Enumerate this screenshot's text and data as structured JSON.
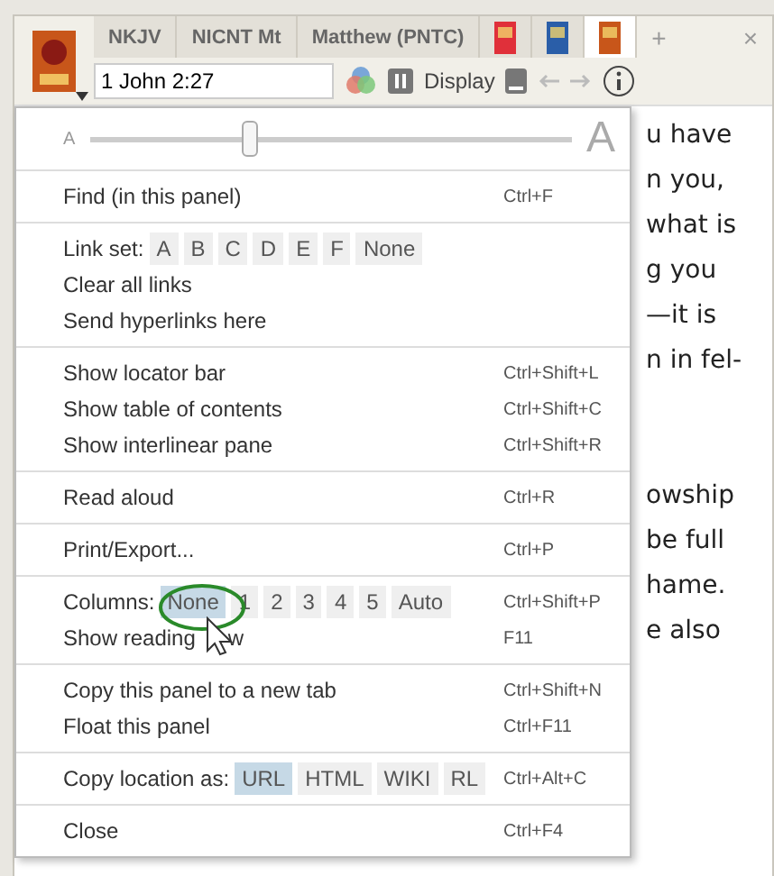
{
  "tabs": [
    {
      "kind": "text",
      "label": "NKJV",
      "selected": false
    },
    {
      "kind": "text",
      "label": "NICNT Mt",
      "selected": false
    },
    {
      "kind": "text",
      "label": "Matthew (PNTC)",
      "selected": false
    },
    {
      "kind": "cover",
      "color": "#e0303a",
      "selected": false
    },
    {
      "kind": "cover",
      "color": "#2a5ea8",
      "selected": false
    },
    {
      "kind": "cover",
      "color": "#c8561a",
      "selected": true
    }
  ],
  "new_tab": "+",
  "close_tab": "×",
  "toolbar": {
    "reference": "1 John 2:27",
    "display": "Display"
  },
  "font_size": {
    "small": "A",
    "large": "A",
    "level": 0.33
  },
  "menu": [
    [
      {
        "kind": "item",
        "label": "Find (in this panel)",
        "shortcut": "Ctrl+F"
      }
    ],
    [
      {
        "kind": "choices",
        "label": "Link set:",
        "options": [
          {
            "label": "A",
            "selected": false
          },
          {
            "label": "B",
            "selected": false
          },
          {
            "label": "C",
            "selected": false
          },
          {
            "label": "D",
            "selected": false
          },
          {
            "label": "E",
            "selected": false
          },
          {
            "label": "F",
            "selected": false
          },
          {
            "label": "None",
            "selected": false
          }
        ]
      },
      {
        "kind": "item",
        "label": "Clear all links"
      },
      {
        "kind": "item",
        "label": "Send hyperlinks here"
      }
    ],
    [
      {
        "kind": "item",
        "label": "Show locator bar",
        "shortcut": "Ctrl+Shift+L"
      },
      {
        "kind": "item",
        "label": "Show table of contents",
        "shortcut": "Ctrl+Shift+C"
      },
      {
        "kind": "item",
        "label": "Show interlinear pane",
        "shortcut": "Ctrl+Shift+R"
      }
    ],
    [
      {
        "kind": "item",
        "label": "Read aloud",
        "shortcut": "Ctrl+R"
      }
    ],
    [
      {
        "kind": "item",
        "label": "Print/Export...",
        "shortcut": "Ctrl+P"
      }
    ],
    [
      {
        "kind": "choices",
        "label": "Columns:",
        "shortcut": "Ctrl+Shift+P",
        "options": [
          {
            "label": "None",
            "selected": true
          },
          {
            "label": "1",
            "selected": false
          },
          {
            "label": "2",
            "selected": false
          },
          {
            "label": "3",
            "selected": false
          },
          {
            "label": "4",
            "selected": false
          },
          {
            "label": "5",
            "selected": false
          },
          {
            "label": "Auto",
            "selected": false
          }
        ]
      },
      {
        "kind": "item",
        "label": "Show reading",
        "tail": "w",
        "shortcut": "F11"
      }
    ],
    [
      {
        "kind": "item",
        "label": "Copy this panel to a new tab",
        "shortcut": "Ctrl+Shift+N"
      },
      {
        "kind": "item",
        "label": "Float this panel",
        "shortcut": "Ctrl+F11"
      }
    ],
    [
      {
        "kind": "choices",
        "label": "Copy location as:",
        "shortcut": "Ctrl+Alt+C",
        "options": [
          {
            "label": "URL",
            "selected": true
          },
          {
            "label": "HTML",
            "selected": false
          },
          {
            "label": "WIKI",
            "selected": false
          },
          {
            "label": "RL",
            "selected": false
          }
        ]
      }
    ],
    [
      {
        "kind": "item",
        "label": "Close",
        "shortcut": "Ctrl+F4"
      }
    ]
  ],
  "paragraphs": [
    [
      "u have",
      "n you,",
      "what is",
      "g you",
      "—it is",
      "n in fel-"
    ],
    [
      "owship",
      "be full",
      "hame.",
      "e also"
    ]
  ]
}
